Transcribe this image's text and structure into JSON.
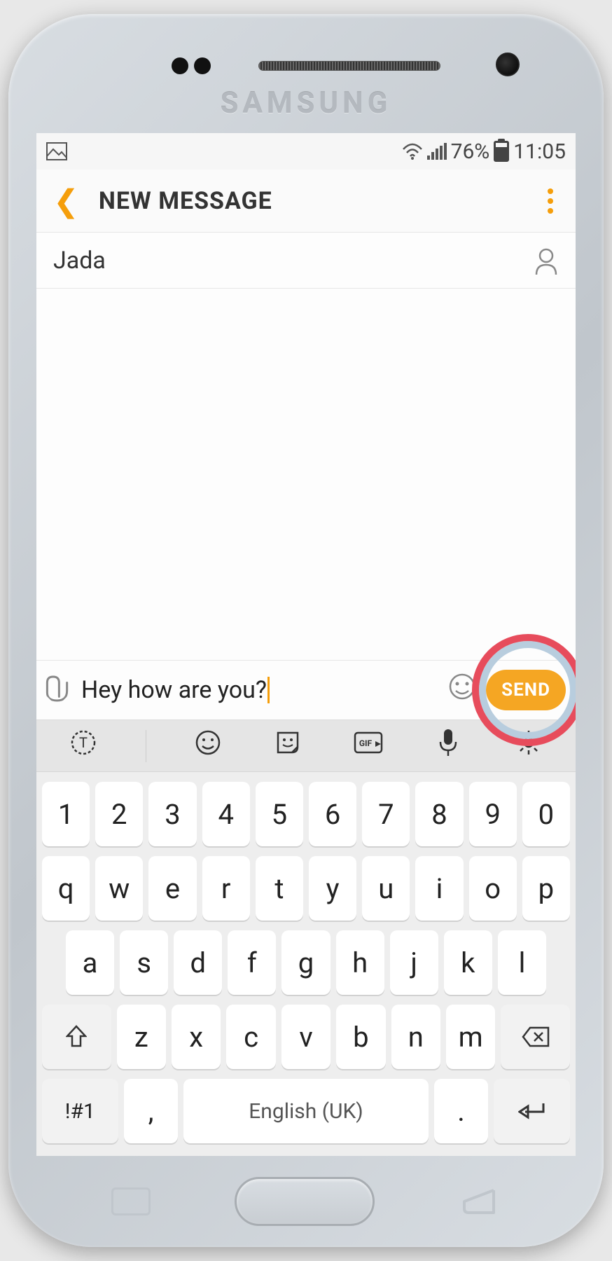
{
  "device": {
    "brand": "SAMSUNG"
  },
  "status_bar": {
    "battery_pct": "76%",
    "time": "11:05"
  },
  "header": {
    "title": "NEW MESSAGE"
  },
  "recipient": {
    "name": "Jada"
  },
  "compose": {
    "text": "Hey how are you?",
    "send_label": "SEND"
  },
  "keyboard": {
    "toolbar": [
      "text-mode",
      "emoji",
      "sticker",
      "gif",
      "mic",
      "settings"
    ],
    "row1": [
      "1",
      "2",
      "3",
      "4",
      "5",
      "6",
      "7",
      "8",
      "9",
      "0"
    ],
    "row2": [
      "q",
      "w",
      "e",
      "r",
      "t",
      "y",
      "u",
      "i",
      "o",
      "p"
    ],
    "row3": [
      "a",
      "s",
      "d",
      "f",
      "g",
      "h",
      "j",
      "k",
      "l"
    ],
    "row4": [
      "z",
      "x",
      "c",
      "v",
      "b",
      "n",
      "m"
    ],
    "symbols_key": "!#1",
    "comma": ",",
    "period": ".",
    "space_label": "English (UK)"
  }
}
